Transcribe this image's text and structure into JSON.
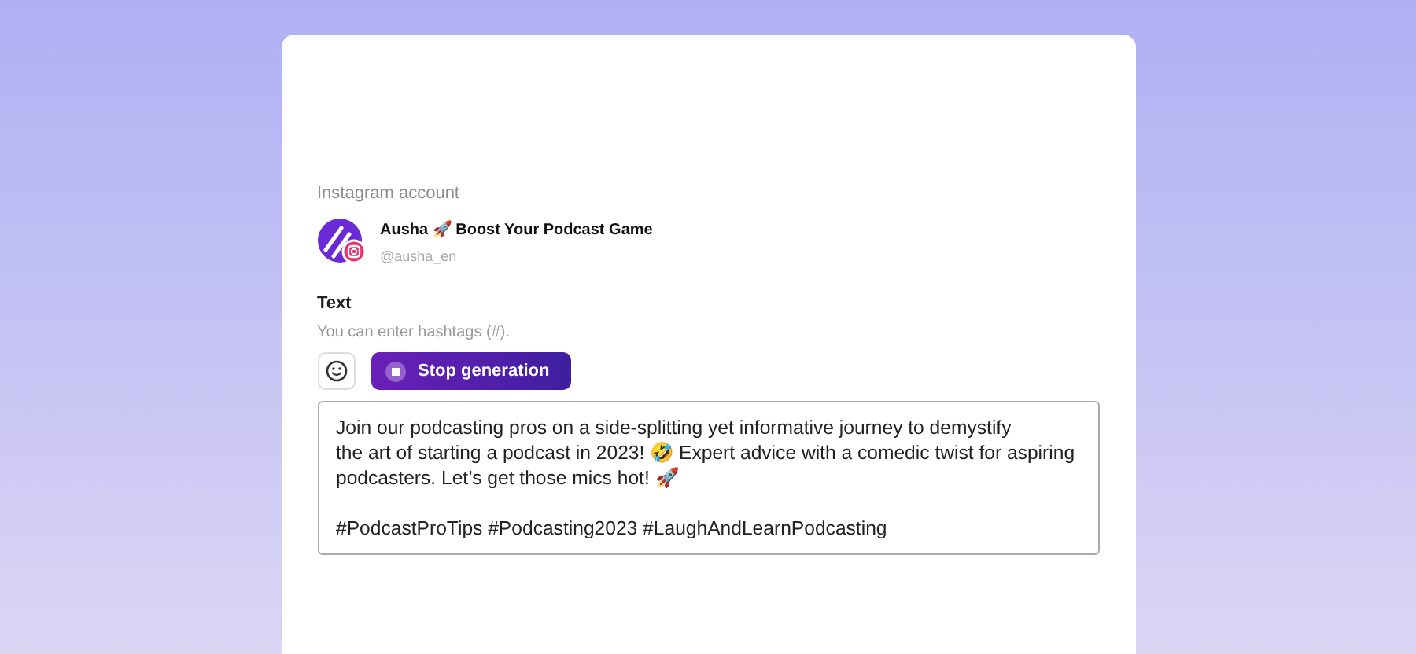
{
  "account_section": {
    "label": "Instagram account",
    "name": "Ausha 🚀 Boost Your Podcast Game",
    "handle": "@ausha_en"
  },
  "text_section": {
    "label": "Text",
    "hint": "You can enter hashtags (#).",
    "stop_button": "Stop generation",
    "generating": true,
    "value": "Join our podcasting pros on a side-splitting yet informative journey to demystify\nthe art of starting a podcast in 2023! 🤣 Expert advice with a comedic twist for aspiring\npodcasters. Let’s get those mics hot! 🚀\n\n#PodcastProTips #Podcasting2023 #LaughAndLearnPodcasting"
  }
}
